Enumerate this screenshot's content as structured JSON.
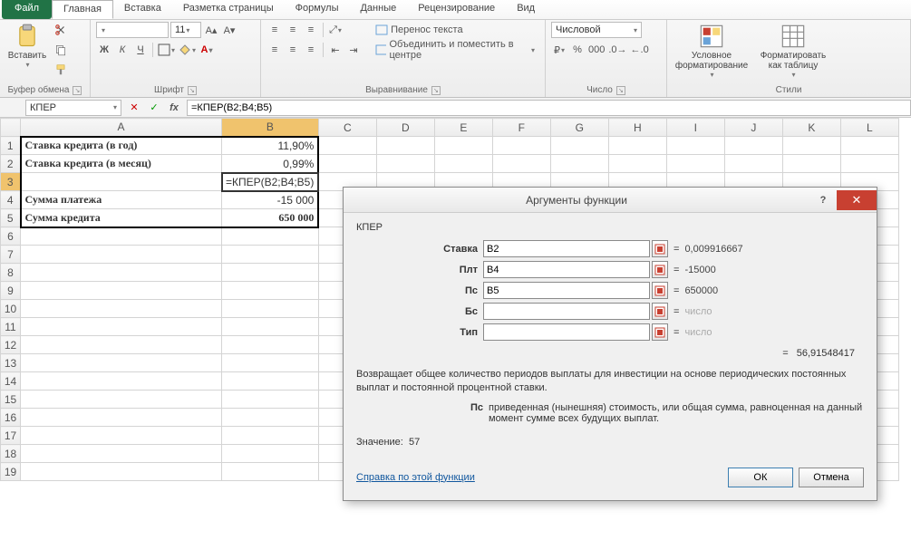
{
  "tabs": {
    "file": "Файл",
    "items": [
      "Главная",
      "Вставка",
      "Разметка страницы",
      "Формулы",
      "Данные",
      "Рецензирование",
      "Вид"
    ],
    "active": 0
  },
  "ribbon": {
    "clipboard": {
      "label": "Буфер обмена",
      "paste": "Вставить"
    },
    "font": {
      "label": "Шрифт",
      "name": "",
      "size": "11",
      "b": "Ж",
      "i": "К",
      "u": "Ч"
    },
    "align": {
      "label": "Выравнивание",
      "wrap": "Перенос текста",
      "merge": "Объединить и поместить в центре"
    },
    "number": {
      "label": "Число",
      "format": "Числовой"
    },
    "styles": {
      "label": "Стили",
      "cond": "Условное форматирование",
      "table": "Форматировать как таблицу"
    }
  },
  "fbar": {
    "name": "КПЕР",
    "formula": "=КПЕР(B2;B4;B5)"
  },
  "cols": [
    "A",
    "B",
    "C",
    "D",
    "E",
    "F",
    "G",
    "H",
    "I",
    "J",
    "K",
    "L"
  ],
  "cells": {
    "A1": "Ставка кредита (в год)",
    "B1": "11,90%",
    "A2": "Ставка кредита (в месяц)",
    "B2": "0,99%",
    "B3": "=КПЕР(B2;B4;B5)",
    "A4": "Сумма платежа",
    "B4": "-15 000",
    "A5": "Сумма кредита",
    "B5": "650 000"
  },
  "dialog": {
    "title": "Аргументы функции",
    "fname": "КПЕР",
    "args": [
      {
        "label": "Ставка",
        "value": "B2",
        "result": "0,009916667"
      },
      {
        "label": "Плт",
        "value": "B4",
        "result": "-15000"
      },
      {
        "label": "Пс",
        "value": "B5",
        "result": "650000",
        "cursor": true
      },
      {
        "label": "Бс",
        "value": "",
        "result": "число",
        "dim": true
      },
      {
        "label": "Тип",
        "value": "",
        "result": "число",
        "dim": true
      }
    ],
    "total": "56,91548417",
    "desc": "Возвращает общее количество периодов выплаты для инвестиции на основе периодических постоянных выплат и постоянной процентной ставки.",
    "argdesc_label": "Пс",
    "argdesc_text": "приведенная (нынешняя) стоимость, или общая сумма, равноценная на данный момент сумме всех будущих выплат.",
    "value_label": "Значение:",
    "value": "57",
    "help": "Справка по этой функции",
    "ok": "ОК",
    "cancel": "Отмена"
  }
}
